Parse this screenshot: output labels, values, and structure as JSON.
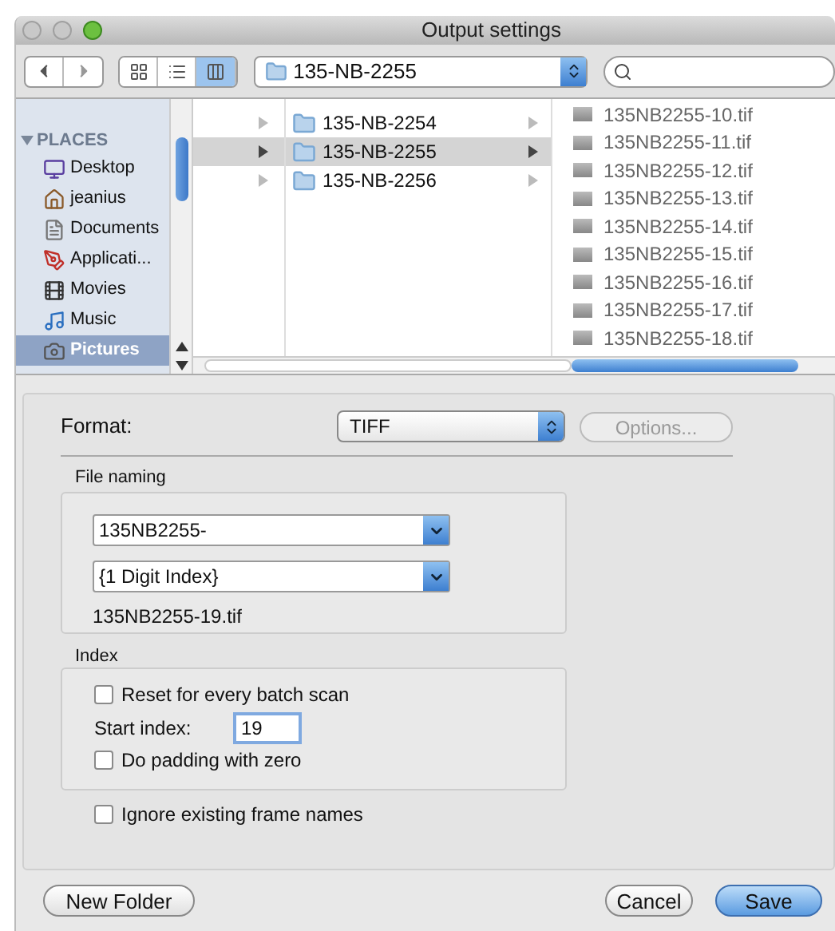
{
  "window": {
    "title": "Output settings"
  },
  "toolbar": {
    "view_modes": [
      {
        "kind": "icons",
        "selected": false
      },
      {
        "kind": "list",
        "selected": false
      },
      {
        "kind": "columns",
        "selected": true
      }
    ],
    "path": "135-NB-2255"
  },
  "sidebar": {
    "heading": "PLACES",
    "expanded": true,
    "items": [
      {
        "label": "Desktop",
        "selected": false
      },
      {
        "label": "jeanius",
        "selected": false
      },
      {
        "label": "Documents",
        "selected": false
      },
      {
        "label": "Applicati...",
        "selected": false
      },
      {
        "label": "Movies",
        "selected": false
      },
      {
        "label": "Music",
        "selected": false
      },
      {
        "label": "Pictures",
        "selected": true
      }
    ]
  },
  "column_1": {
    "rows": [
      {
        "selected": false
      },
      {
        "selected": true
      },
      {
        "selected": false
      }
    ]
  },
  "column_2": {
    "rows": [
      {
        "label": "135-NB-2254",
        "selected": false
      },
      {
        "label": "135-NB-2255",
        "selected": true
      },
      {
        "label": "135-NB-2256",
        "selected": false
      }
    ]
  },
  "column_3": {
    "rows": [
      {
        "label": "135NB2255-10.tif"
      },
      {
        "label": "135NB2255-11.tif"
      },
      {
        "label": "135NB2255-12.tif"
      },
      {
        "label": "135NB2255-13.tif"
      },
      {
        "label": "135NB2255-14.tif"
      },
      {
        "label": "135NB2255-15.tif"
      },
      {
        "label": "135NB2255-16.tif"
      },
      {
        "label": "135NB2255-17.tif"
      },
      {
        "label": "135NB2255-18.tif"
      }
    ]
  },
  "format": {
    "label": "Format:",
    "value": "TIFF",
    "options_button": {
      "label": "Options...",
      "disabled": true
    }
  },
  "file_naming": {
    "heading": "File naming",
    "prefix": "135NB2255-",
    "index_format": "{1 Digit Index}",
    "preview": "135NB2255-19.tif"
  },
  "index": {
    "heading": "Index",
    "reset": {
      "label": "Reset for every batch scan",
      "checked": false
    },
    "start_label": "Start index:",
    "start_value": "19",
    "padding": {
      "label": "Do padding with zero",
      "checked": false
    }
  },
  "ignore_names": {
    "label": "Ignore existing frame names",
    "checked": false
  },
  "buttons": {
    "new_folder": "New Folder",
    "cancel": "Cancel",
    "save": "Save"
  }
}
